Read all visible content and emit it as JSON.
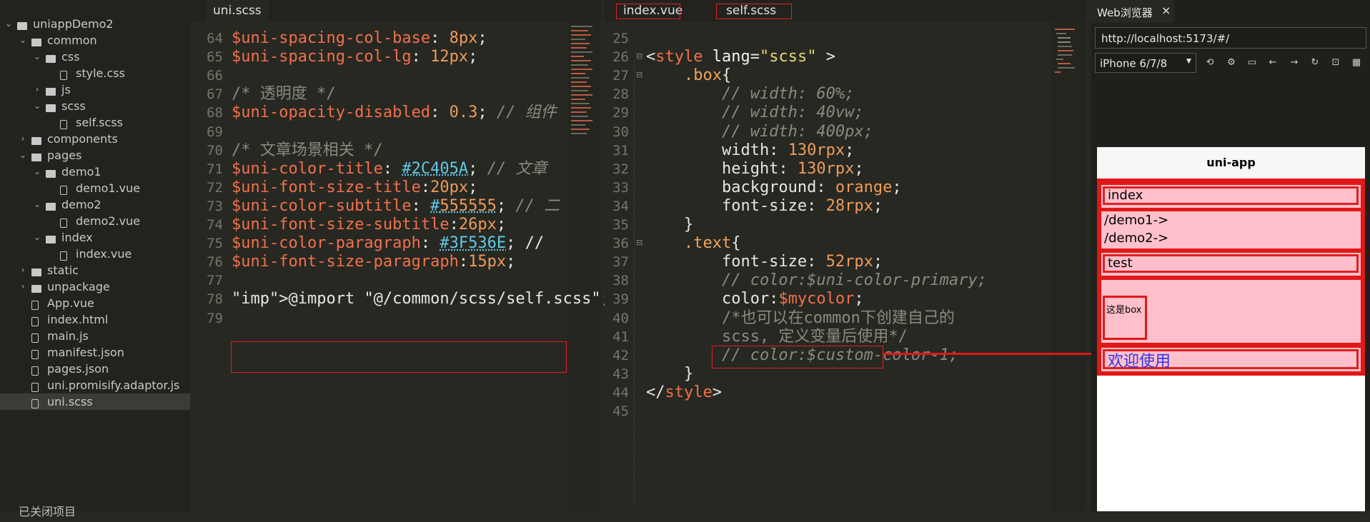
{
  "sidebar": {
    "items": [
      {
        "label": "uniappDemo2",
        "type": "project",
        "depth": 0,
        "expanded": true
      },
      {
        "label": "common",
        "type": "folder",
        "depth": 1,
        "expanded": true
      },
      {
        "label": "css",
        "type": "folder",
        "depth": 2,
        "expanded": true
      },
      {
        "label": "style.css",
        "type": "file-braces",
        "depth": 3
      },
      {
        "label": "js",
        "type": "folder",
        "depth": 2,
        "expanded": false
      },
      {
        "label": "scss",
        "type": "folder",
        "depth": 2,
        "expanded": true
      },
      {
        "label": "self.scss",
        "type": "file-scss",
        "depth": 3
      },
      {
        "label": "components",
        "type": "folder",
        "depth": 1,
        "expanded": false
      },
      {
        "label": "pages",
        "type": "folder",
        "depth": 1,
        "expanded": true
      },
      {
        "label": "demo1",
        "type": "folder",
        "depth": 2,
        "expanded": true
      },
      {
        "label": "demo1.vue",
        "type": "file-vue",
        "depth": 3
      },
      {
        "label": "demo2",
        "type": "folder",
        "depth": 2,
        "expanded": true
      },
      {
        "label": "demo2.vue",
        "type": "file-vue",
        "depth": 3
      },
      {
        "label": "index",
        "type": "folder",
        "depth": 2,
        "expanded": true
      },
      {
        "label": "index.vue",
        "type": "file-vue",
        "depth": 3
      },
      {
        "label": "static",
        "type": "folder",
        "depth": 1,
        "expanded": false
      },
      {
        "label": "unpackage",
        "type": "folder",
        "depth": 1,
        "expanded": false
      },
      {
        "label": "App.vue",
        "type": "file-vue",
        "depth": 1
      },
      {
        "label": "index.html",
        "type": "file-html",
        "depth": 1
      },
      {
        "label": "main.js",
        "type": "file",
        "depth": 1
      },
      {
        "label": "manifest.json",
        "type": "file-json",
        "depth": 1
      },
      {
        "label": "pages.json",
        "type": "file-brackets",
        "depth": 1
      },
      {
        "label": "uni.promisify.adaptor.js",
        "type": "file",
        "depth": 1
      },
      {
        "label": "uni.scss",
        "type": "file-scss",
        "depth": 1,
        "selected": true
      }
    ],
    "footer": "已关闭项目"
  },
  "editor1": {
    "tab": "uni.scss",
    "lines": [
      {
        "n": "64",
        "t": "$uni-spacing-col-base: 8px;"
      },
      {
        "n": "65",
        "t": "$uni-spacing-col-lg: 12px;"
      },
      {
        "n": "66",
        "t": ""
      },
      {
        "n": "67",
        "t": "/* 透明度 */"
      },
      {
        "n": "68",
        "t": "$uni-opacity-disabled: 0.3; // 组件"
      },
      {
        "n": "69",
        "t": ""
      },
      {
        "n": "70",
        "t": "/* 文章场景相关 */"
      },
      {
        "n": "71",
        "t": "$uni-color-title: #2C405A; // 文章"
      },
      {
        "n": "72",
        "t": "$uni-font-size-title:20px;"
      },
      {
        "n": "73",
        "t": "$uni-color-subtitle: #555555; // 二"
      },
      {
        "n": "74",
        "t": "$uni-font-size-subtitle:26px;"
      },
      {
        "n": "75",
        "t": "$uni-color-paragraph: #3F536E; //"
      },
      {
        "n": "76",
        "t": "$uni-font-size-paragraph:15px;"
      },
      {
        "n": "77",
        "t": ""
      },
      {
        "n": "78",
        "t": "@import \"@/common/scss/self.scss\";"
      },
      {
        "n": "79",
        "t": ""
      }
    ]
  },
  "editor2": {
    "tabs": [
      "index.vue",
      "self.scss"
    ],
    "lines": [
      {
        "n": "25",
        "t": ""
      },
      {
        "n": "26",
        "t": "<style lang=\"scss\" >"
      },
      {
        "n": "27",
        "t": "    .box{"
      },
      {
        "n": "28",
        "t": "        // width: 60%;"
      },
      {
        "n": "29",
        "t": "        // width: 40vw;"
      },
      {
        "n": "30",
        "t": "        // width: 400px;"
      },
      {
        "n": "31",
        "t": "        width: 130rpx;"
      },
      {
        "n": "32",
        "t": "        height: 130rpx;"
      },
      {
        "n": "33",
        "t": "        background: orange;"
      },
      {
        "n": "34",
        "t": "        font-size: 28rpx;"
      },
      {
        "n": "35",
        "t": "    }"
      },
      {
        "n": "36",
        "t": "    .text{"
      },
      {
        "n": "37",
        "t": "        font-size: 52rpx;"
      },
      {
        "n": "38",
        "t": "        // color:$uni-color-primary;"
      },
      {
        "n": "39",
        "t": "        color:$mycolor;"
      },
      {
        "n": "40",
        "t": "        /*也可以在common下创建自己的"
      },
      {
        "n": "41",
        "t": "        scss, 定义变量后使用*/"
      },
      {
        "n": "42",
        "t": "        // color:$custom-color-1;"
      },
      {
        "n": "43",
        "t": "    }"
      },
      {
        "n": "44",
        "t": "</style>"
      },
      {
        "n": "45",
        "t": ""
      }
    ]
  },
  "browser": {
    "tab": "Web浏览器",
    "close": "×",
    "url": "http://localhost:5173/#/",
    "device": "iPhone 6/7/8",
    "nav_title": "uni-app",
    "items": {
      "index": "index",
      "demo1": "/demo1->",
      "demo2": "/demo2->",
      "test": "test",
      "box": "这是box",
      "welcome": "欢迎使用"
    }
  },
  "colors": {
    "accent_red": "#e01818",
    "pink": "#ffc0cb",
    "welcome_text": "#3333ee"
  }
}
